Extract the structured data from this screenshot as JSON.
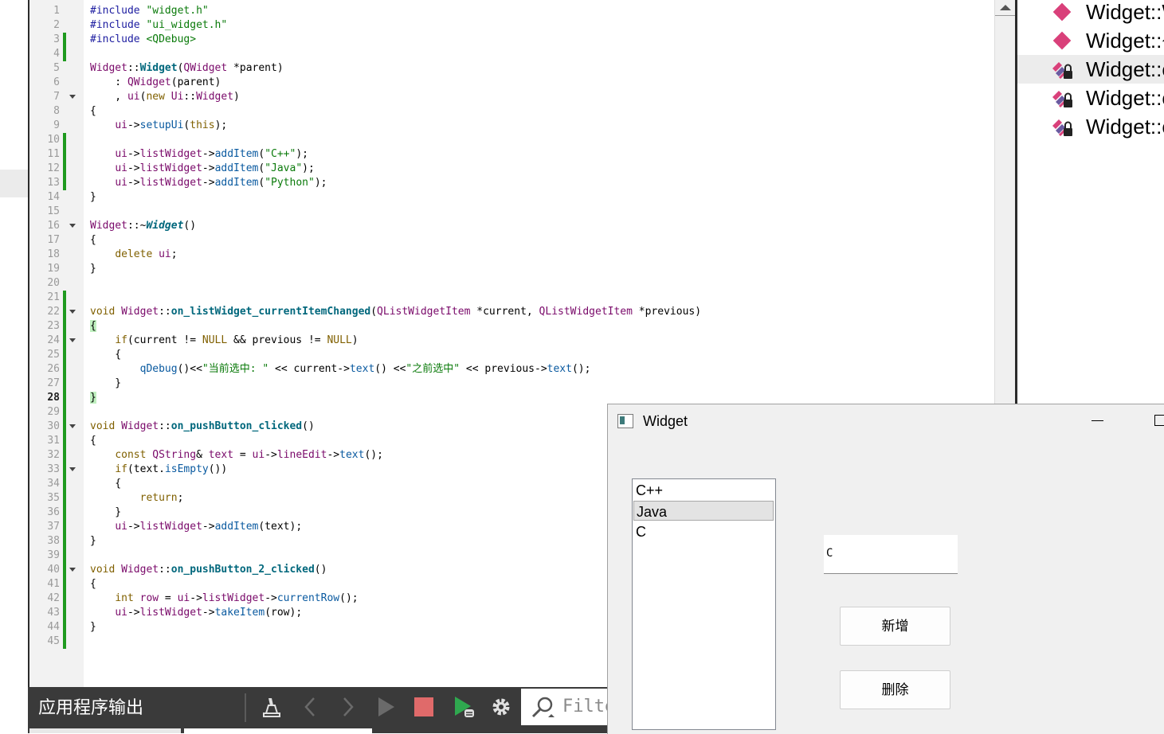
{
  "editor": {
    "current_line": "28",
    "lines": [
      {
        "n": "1",
        "segs": [
          [
            "pp",
            "#include "
          ],
          [
            "str",
            "\"widget.h\""
          ]
        ]
      },
      {
        "n": "2",
        "segs": [
          [
            "pp",
            "#include "
          ],
          [
            "str",
            "\"ui_widget.h\""
          ]
        ]
      },
      {
        "n": "3",
        "mod": true,
        "segs": [
          [
            "pp",
            "#include "
          ],
          [
            "str",
            "<QDebug>"
          ]
        ]
      },
      {
        "n": "4",
        "mod": true,
        "segs": []
      },
      {
        "n": "5",
        "segs": [
          [
            "cls",
            "Widget"
          ],
          [
            "",
            "::"
          ],
          [
            "bold",
            "Widget"
          ],
          [
            "",
            "("
          ],
          [
            "cls",
            "QWidget"
          ],
          [
            "",
            " *parent)"
          ]
        ]
      },
      {
        "n": "6",
        "segs": [
          [
            "",
            "    : "
          ],
          [
            "cls",
            "QWidget"
          ],
          [
            "",
            "(parent)"
          ]
        ]
      },
      {
        "n": "7",
        "fold": true,
        "segs": [
          [
            "",
            "    , "
          ],
          [
            "cls",
            "ui"
          ],
          [
            "",
            "("
          ],
          [
            "kw",
            "new"
          ],
          [
            "",
            " "
          ],
          [
            "cls",
            "Ui"
          ],
          [
            "",
            "::"
          ],
          [
            "cls",
            "Widget"
          ],
          [
            "",
            ")"
          ]
        ]
      },
      {
        "n": "8",
        "segs": [
          [
            "",
            "{"
          ]
        ]
      },
      {
        "n": "9",
        "segs": [
          [
            "",
            "    "
          ],
          [
            "cls",
            "ui"
          ],
          [
            "",
            "->"
          ],
          [
            "fn",
            "setupUi"
          ],
          [
            "",
            "("
          ],
          [
            "kw",
            "this"
          ],
          [
            "",
            ");"
          ]
        ]
      },
      {
        "n": "10",
        "mod": true,
        "segs": []
      },
      {
        "n": "11",
        "mod": true,
        "segs": [
          [
            "",
            "    "
          ],
          [
            "cls",
            "ui"
          ],
          [
            "",
            "->"
          ],
          [
            "cls",
            "listWidget"
          ],
          [
            "",
            "->"
          ],
          [
            "fn",
            "addItem"
          ],
          [
            "",
            "("
          ],
          [
            "str",
            "\"C++\""
          ],
          [
            "",
            ");"
          ]
        ]
      },
      {
        "n": "12",
        "mod": true,
        "segs": [
          [
            "",
            "    "
          ],
          [
            "cls",
            "ui"
          ],
          [
            "",
            "->"
          ],
          [
            "cls",
            "listWidget"
          ],
          [
            "",
            "->"
          ],
          [
            "fn",
            "addItem"
          ],
          [
            "",
            "("
          ],
          [
            "str",
            "\"Java\""
          ],
          [
            "",
            ");"
          ]
        ]
      },
      {
        "n": "13",
        "mod": true,
        "segs": [
          [
            "",
            "    "
          ],
          [
            "cls",
            "ui"
          ],
          [
            "",
            "->"
          ],
          [
            "cls",
            "listWidget"
          ],
          [
            "",
            "->"
          ],
          [
            "fn",
            "addItem"
          ],
          [
            "",
            "("
          ],
          [
            "str",
            "\"Python\""
          ],
          [
            "",
            ");"
          ]
        ]
      },
      {
        "n": "14",
        "segs": [
          [
            "",
            "}"
          ]
        ]
      },
      {
        "n": "15",
        "segs": []
      },
      {
        "n": "16",
        "fold": true,
        "segs": [
          [
            "cls",
            "Widget"
          ],
          [
            "",
            "::~"
          ],
          [
            "it",
            "Widget"
          ],
          [
            "",
            "()"
          ]
        ]
      },
      {
        "n": "17",
        "segs": [
          [
            "",
            "{"
          ]
        ]
      },
      {
        "n": "18",
        "segs": [
          [
            "",
            "    "
          ],
          [
            "kw",
            "delete"
          ],
          [
            "",
            " "
          ],
          [
            "cls",
            "ui"
          ],
          [
            "",
            ";"
          ]
        ]
      },
      {
        "n": "19",
        "segs": [
          [
            "",
            "}"
          ]
        ]
      },
      {
        "n": "20",
        "segs": []
      },
      {
        "n": "21",
        "mod": true,
        "segs": []
      },
      {
        "n": "22",
        "mod": true,
        "fold": true,
        "segs": [
          [
            "kw",
            "void"
          ],
          [
            "",
            " "
          ],
          [
            "cls",
            "Widget"
          ],
          [
            "",
            "::"
          ],
          [
            "bold",
            "on_listWidget_currentItemChanged"
          ],
          [
            "",
            "("
          ],
          [
            "cls",
            "QListWidgetItem"
          ],
          [
            "",
            " *current, "
          ],
          [
            "cls",
            "QListWidgetItem"
          ],
          [
            "",
            " *previous)"
          ]
        ]
      },
      {
        "n": "23",
        "mod": true,
        "segs": [
          [
            "brace",
            "{"
          ]
        ]
      },
      {
        "n": "24",
        "mod": true,
        "fold": true,
        "segs": [
          [
            "",
            "    "
          ],
          [
            "kw",
            "if"
          ],
          [
            "",
            "(current != "
          ],
          [
            "kw",
            "NULL"
          ],
          [
            "",
            " && previous != "
          ],
          [
            "kw",
            "NULL"
          ],
          [
            "",
            ")"
          ]
        ]
      },
      {
        "n": "25",
        "mod": true,
        "segs": [
          [
            "",
            "    {"
          ]
        ]
      },
      {
        "n": "26",
        "mod": true,
        "segs": [
          [
            "",
            "        "
          ],
          [
            "fn",
            "qDebug"
          ],
          [
            "",
            "()<<"
          ],
          [
            "str",
            "\"当前选中: \""
          ],
          [
            "",
            " << current->"
          ],
          [
            "fn",
            "text"
          ],
          [
            "",
            "() <<"
          ],
          [
            "str",
            "\"之前选中\""
          ],
          [
            "",
            " << previous->"
          ],
          [
            "fn",
            "text"
          ],
          [
            "",
            "();"
          ]
        ]
      },
      {
        "n": "27",
        "mod": true,
        "segs": [
          [
            "",
            "    }"
          ]
        ]
      },
      {
        "n": "28",
        "mod": true,
        "segs": [
          [
            "brace",
            "}"
          ]
        ]
      },
      {
        "n": "29",
        "mod": true,
        "segs": []
      },
      {
        "n": "30",
        "mod": true,
        "fold": true,
        "segs": [
          [
            "kw",
            "void"
          ],
          [
            "",
            " "
          ],
          [
            "cls",
            "Widget"
          ],
          [
            "",
            "::"
          ],
          [
            "bold",
            "on_pushButton_clicked"
          ],
          [
            "",
            "()"
          ]
        ]
      },
      {
        "n": "31",
        "mod": true,
        "segs": [
          [
            "",
            "{"
          ]
        ]
      },
      {
        "n": "32",
        "mod": true,
        "segs": [
          [
            "",
            "    "
          ],
          [
            "kw",
            "const"
          ],
          [
            "",
            " "
          ],
          [
            "cls",
            "QString"
          ],
          [
            "",
            "& "
          ],
          [
            "cls",
            "text"
          ],
          [
            "",
            " = "
          ],
          [
            "cls",
            "ui"
          ],
          [
            "",
            "->"
          ],
          [
            "cls",
            "lineEdit"
          ],
          [
            "",
            "->"
          ],
          [
            "fn",
            "text"
          ],
          [
            "",
            "();"
          ]
        ]
      },
      {
        "n": "33",
        "mod": true,
        "fold": true,
        "segs": [
          [
            "",
            "    "
          ],
          [
            "kw",
            "if"
          ],
          [
            "",
            "(text."
          ],
          [
            "fn",
            "isEmpty"
          ],
          [
            "",
            "())"
          ]
        ]
      },
      {
        "n": "34",
        "mod": true,
        "segs": [
          [
            "",
            "    {"
          ]
        ]
      },
      {
        "n": "35",
        "mod": true,
        "segs": [
          [
            "",
            "        "
          ],
          [
            "kw",
            "return"
          ],
          [
            "",
            ";"
          ]
        ]
      },
      {
        "n": "36",
        "mod": true,
        "segs": [
          [
            "",
            "    }"
          ]
        ]
      },
      {
        "n": "37",
        "mod": true,
        "segs": [
          [
            "",
            "    "
          ],
          [
            "cls",
            "ui"
          ],
          [
            "",
            "->"
          ],
          [
            "cls",
            "listWidget"
          ],
          [
            "",
            "->"
          ],
          [
            "fn",
            "addItem"
          ],
          [
            "",
            "(text);"
          ]
        ]
      },
      {
        "n": "38",
        "mod": true,
        "segs": [
          [
            "",
            "}"
          ]
        ]
      },
      {
        "n": "39",
        "mod": true,
        "segs": []
      },
      {
        "n": "40",
        "mod": true,
        "fold": true,
        "segs": [
          [
            "kw",
            "void"
          ],
          [
            "",
            " "
          ],
          [
            "cls",
            "Widget"
          ],
          [
            "",
            "::"
          ],
          [
            "bold",
            "on_pushButton_2_clicked"
          ],
          [
            "",
            "()"
          ]
        ]
      },
      {
        "n": "41",
        "mod": true,
        "segs": [
          [
            "",
            "{"
          ]
        ]
      },
      {
        "n": "42",
        "mod": true,
        "segs": [
          [
            "",
            "    "
          ],
          [
            "kw",
            "int"
          ],
          [
            "",
            " "
          ],
          [
            "cls",
            "row"
          ],
          [
            "",
            " = "
          ],
          [
            "cls",
            "ui"
          ],
          [
            "",
            "->"
          ],
          [
            "cls",
            "listWidget"
          ],
          [
            "",
            "->"
          ],
          [
            "fn",
            "currentRow"
          ],
          [
            "",
            "();"
          ]
        ]
      },
      {
        "n": "43",
        "mod": true,
        "segs": [
          [
            "",
            "    "
          ],
          [
            "cls",
            "ui"
          ],
          [
            "",
            "->"
          ],
          [
            "cls",
            "listWidget"
          ],
          [
            "",
            "->"
          ],
          [
            "fn",
            "takeItem"
          ],
          [
            "",
            "(row);"
          ]
        ]
      },
      {
        "n": "44",
        "mod": true,
        "segs": [
          [
            "",
            "}"
          ]
        ]
      },
      {
        "n": "45",
        "mod": true,
        "segs": []
      }
    ]
  },
  "outline": {
    "items": [
      {
        "label": "Widget::W",
        "icon": "public-method-icon"
      },
      {
        "label": "Widget::~",
        "icon": "public-method-icon"
      },
      {
        "label": "Widget::o",
        "icon": "private-slot-icon",
        "selected": true
      },
      {
        "label": "Widget::o",
        "icon": "private-slot-icon"
      },
      {
        "label": "Widget::o",
        "icon": "private-slot-icon"
      }
    ]
  },
  "output_pane": {
    "title": "应用程序输出",
    "filter_placeholder": "Filter"
  },
  "app_window": {
    "title": "Widget",
    "list_items": [
      "C++",
      "Java",
      "C"
    ],
    "selected_index": 1,
    "line_edit_value": "C",
    "add_button": "新增",
    "delete_button": "删除"
  },
  "colors": {
    "accent_green": "#1f9a1f",
    "method_pink": "#d9407a",
    "output_bar": "#3a3a3a"
  }
}
